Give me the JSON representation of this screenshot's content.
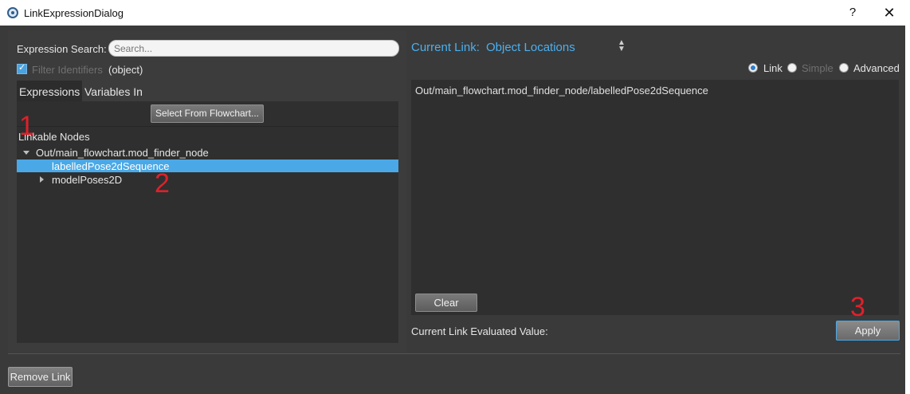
{
  "window": {
    "title": "LinkExpressionDialog",
    "help_label": "?",
    "close_label": "✕"
  },
  "left": {
    "search_label": "Expression Search:",
    "search_placeholder": "Search...",
    "filter_checked": true,
    "filter_label": "Filter Identifiers",
    "filter_object": "(object)",
    "tabs": [
      {
        "label": "Expressions",
        "active": true
      },
      {
        "label": "Variables In",
        "active": false
      }
    ],
    "select_button": "Select From Flowchart...",
    "linkable_title": "Linkable Nodes",
    "tree": {
      "root": "Out/main_flowchart.mod_finder_node",
      "children": [
        {
          "label": "labelledPose2dSequence",
          "selected": true
        },
        {
          "label": "modelPoses2D",
          "selected": false
        }
      ]
    }
  },
  "right": {
    "current_link_label": "Current Link:",
    "current_link_value": "Object Locations",
    "modes": [
      {
        "label": "Link",
        "checked": true
      },
      {
        "label": "Simple",
        "checked": false
      },
      {
        "label": "Advanced",
        "checked": false
      }
    ],
    "expression": "Out/main_flowchart.mod_finder_node/labelledPose2dSequence",
    "clear_button": "Clear",
    "eval_label": "Current Link Evaluated Value:",
    "apply_button": "Apply"
  },
  "bottom": {
    "remove_button": "Remove Link"
  },
  "annotations": [
    "1",
    "2",
    "3"
  ],
  "colors": {
    "accent": "#4ab0f0",
    "selection": "#4aa8e6",
    "annotation": "#e0202a",
    "background": "#3a3a3a"
  }
}
